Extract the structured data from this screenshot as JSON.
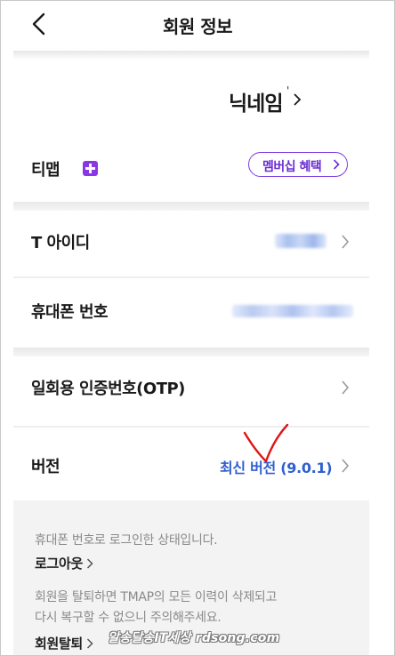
{
  "header": {
    "title": "회원 정보",
    "back_icon": "chevron-left-icon"
  },
  "profile": {
    "nickname": "닉네임",
    "nickname_mark": "'"
  },
  "membership": {
    "label": "티맵",
    "badge_icon": "plus-badge-icon",
    "badge_color": "#8a35e6",
    "button_label": "멤버십 혜택"
  },
  "rows": {
    "t_id": {
      "label": "T 아이디"
    },
    "phone": {
      "label": "휴대폰 번호"
    },
    "otp": {
      "label": "일회용 인증번호(OTP)"
    },
    "version": {
      "label": "버전",
      "value": "최신 버전 (9.0.1)"
    }
  },
  "info": {
    "login_status": "휴대폰 번호로 로그인한 상태입니다.",
    "logout_link": "로그아웃",
    "withdraw_notice_1": "회원을 탈퇴하면 TMAP의 모든 이력이 삭제되고",
    "withdraw_notice_2": "다시 복구할 수 없으니 주의해주세요.",
    "withdraw_link": "회원탈퇴"
  },
  "watermark": "알송달송IT세상 rdsong.com",
  "colors": {
    "accent_purple": "#7b3be0",
    "link_blue": "#2f5fcf",
    "annotation_red": "#e01515"
  }
}
